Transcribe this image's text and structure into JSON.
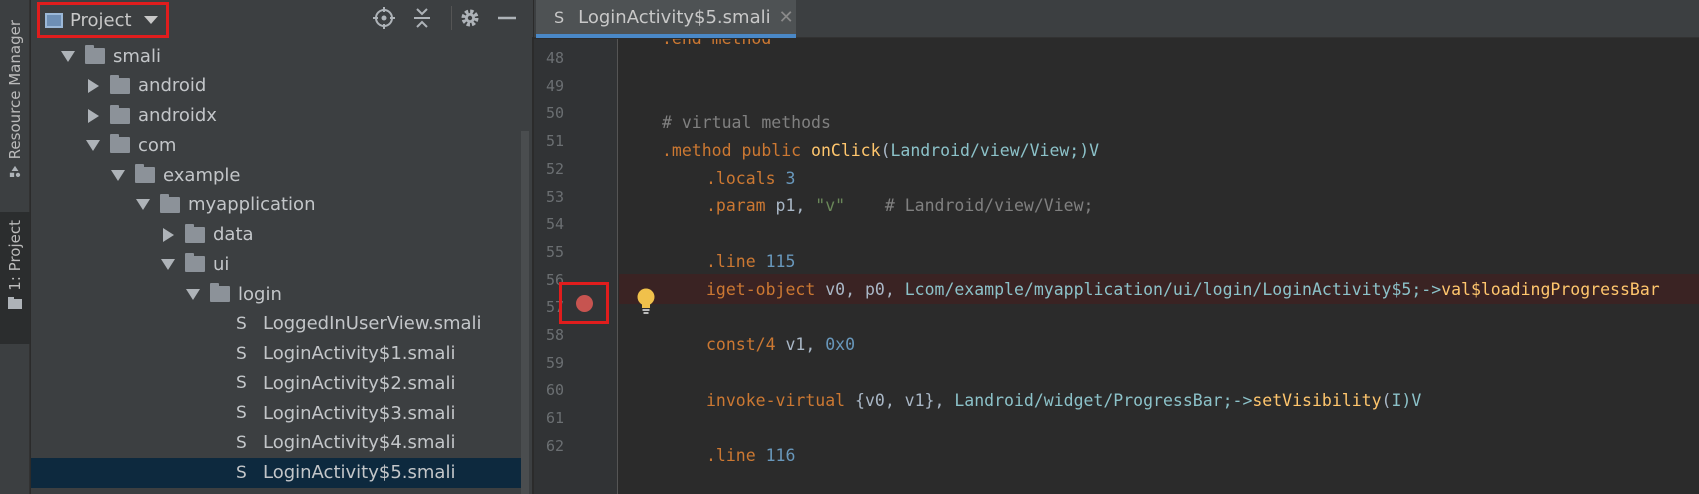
{
  "left_strip": {
    "resource_manager_label": "Resource Manager",
    "project_tab_label": "1: Project"
  },
  "project_panel": {
    "selector_label": "Project",
    "header_buttons": [
      "locate-icon",
      "collapse-all-icon",
      "gear-icon",
      "minimize-icon"
    ],
    "tree": [
      {
        "label": "smali",
        "type": "folder",
        "depth": 0,
        "expanded": true
      },
      {
        "label": "android",
        "type": "folder",
        "depth": 1,
        "expanded": false
      },
      {
        "label": "androidx",
        "type": "folder",
        "depth": 1,
        "expanded": false
      },
      {
        "label": "com",
        "type": "folder",
        "depth": 1,
        "expanded": true
      },
      {
        "label": "example",
        "type": "folder",
        "depth": 2,
        "expanded": true
      },
      {
        "label": "myapplication",
        "type": "folder",
        "depth": 3,
        "expanded": true
      },
      {
        "label": "data",
        "type": "folder",
        "depth": 4,
        "expanded": false
      },
      {
        "label": "ui",
        "type": "folder",
        "depth": 4,
        "expanded": true
      },
      {
        "label": "login",
        "type": "folder",
        "depth": 5,
        "expanded": true
      },
      {
        "label": "LoggedInUserView.smali",
        "type": "file",
        "depth": 6
      },
      {
        "label": "LoginActivity$1.smali",
        "type": "file",
        "depth": 6
      },
      {
        "label": "LoginActivity$2.smali",
        "type": "file",
        "depth": 6
      },
      {
        "label": "LoginActivity$3.smali",
        "type": "file",
        "depth": 6
      },
      {
        "label": "LoginActivity$4.smali",
        "type": "file",
        "depth": 6
      },
      {
        "label": "LoginActivity$5.smali",
        "type": "file",
        "depth": 6,
        "selected": true
      }
    ],
    "file_icon_glyph": "S"
  },
  "editor": {
    "tab": {
      "icon_glyph": "S",
      "label": "LoginActivity$5.smali",
      "close_glyph": "✕"
    },
    "partial_top_line": ".end method",
    "line_numbers": [
      "48",
      "49",
      "50",
      "51",
      "52",
      "53",
      "54",
      "55",
      "56",
      "57",
      "58",
      "59",
      "60",
      "61",
      "62"
    ],
    "breakpoint_line": "56",
    "code": {
      "l50": "# virtual methods",
      "l51": {
        "kw": ".method public ",
        "fn": "onClick",
        "p1": "(",
        "ty": "Landroid/view/View;",
        "p2": ")V"
      },
      "l52": {
        "kw": ".locals ",
        "num": "3"
      },
      "l53": {
        "kw": ".param ",
        "pl": "p1, ",
        "str": "\"v\"",
        "com": "    # Landroid/view/View;"
      },
      "l55": {
        "kw": ".line ",
        "num": "115"
      },
      "l56": {
        "kw": "iget-object ",
        "pl": "v0, p0, ",
        "ty": "Lcom/example/myapplication/ui/login/LoginActivity$5;->",
        "fn": "val$loadingProgressBar"
      },
      "l58": {
        "kw": "const/4 ",
        "pl": "v1, ",
        "num": "0x0"
      },
      "l60": {
        "kw": "invoke-virtual ",
        "pl": "{v0, v1}, ",
        "ty": "Landroid/widget/ProgressBar;->",
        "fn": "setVisibility",
        "p1": "(",
        "ty2": "I",
        "p2": ")V"
      },
      "l62": {
        "kw": ".line ",
        "num": "116"
      }
    }
  }
}
